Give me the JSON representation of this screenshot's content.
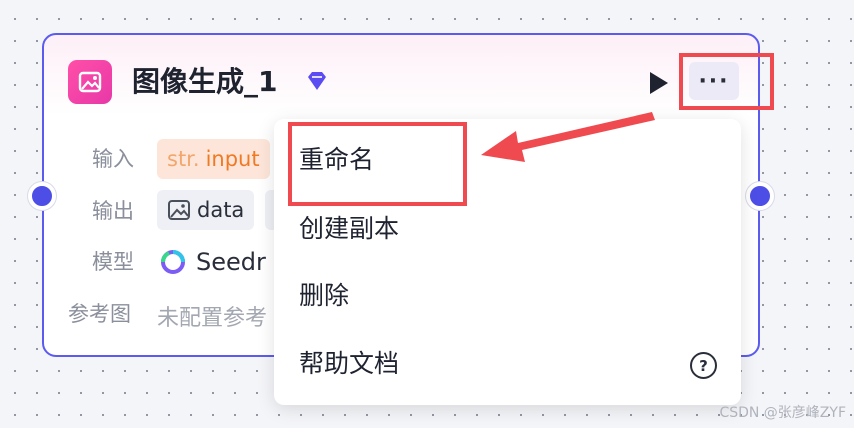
{
  "node": {
    "title": "图像生成_1",
    "input_label": "输入",
    "input_type": "str.",
    "input_value": "input",
    "output_label": "输出",
    "output_value": "data",
    "model_label": "模型",
    "model_value": "Seedr",
    "ref_label": "参考图",
    "ref_value": "未配置参考",
    "more_label": "···"
  },
  "menu": {
    "items": [
      {
        "label": "重命名"
      },
      {
        "label": "创建副本"
      },
      {
        "label": "删除"
      },
      {
        "label": "帮助文档"
      }
    ],
    "help_symbol": "?"
  },
  "colors": {
    "accent": "#5b5bf0",
    "port": "#4d4ee6",
    "highlight": "#ef4a4f",
    "node_icon": "#ff4fa8"
  },
  "watermark": "CSDN @张彦峰ZYF"
}
